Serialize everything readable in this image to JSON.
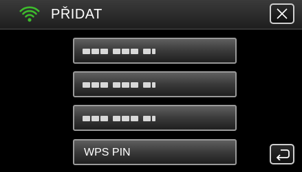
{
  "header": {
    "title": "PŘIDAT",
    "wifi_icon": "wifi-icon",
    "wifi_color": "#3dbb2c",
    "close_icon": "close-icon"
  },
  "list": {
    "items": [
      {
        "label": "",
        "masked": true
      },
      {
        "label": "",
        "masked": true
      },
      {
        "label": "",
        "masked": true
      },
      {
        "label": "WPS PIN",
        "masked": false
      }
    ]
  },
  "footer": {
    "return_icon": "return-icon"
  }
}
